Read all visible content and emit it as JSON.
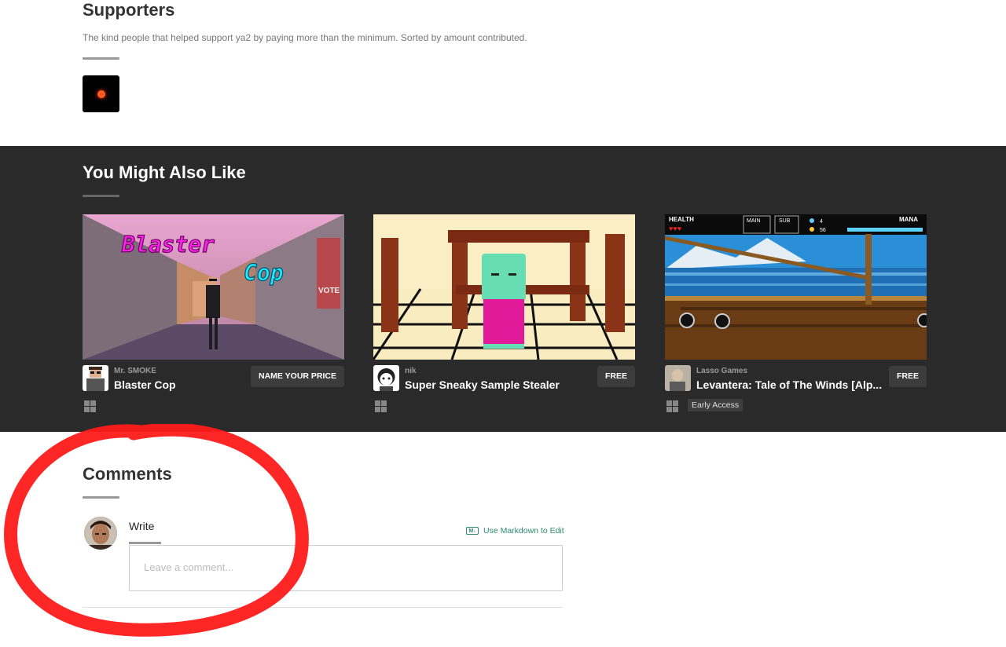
{
  "supporters": {
    "title": "Supporters",
    "description": "The kind people that helped support ya2 by paying more than the minimum. Sorted by amount contributed."
  },
  "also_like": {
    "title": "You Might Also Like",
    "games": [
      {
        "author": "Mr. SMOKE",
        "title": "Blaster Cop",
        "price": "NAME YOUR PRICE",
        "tag": ""
      },
      {
        "author": "nik",
        "title": "Super Sneaky Sample Stealer",
        "price": "FREE",
        "tag": ""
      },
      {
        "author": "Lasso Games",
        "title": "Levantera: Tale of The Winds [Alp...",
        "price": "FREE",
        "tag": "Early Access"
      }
    ],
    "thumb_text": {
      "blaster_line1": "Blaster",
      "blaster_line2": "Cop",
      "vote": "VOTE",
      "hud_health": "HEALTH",
      "hud_main": "MAIN",
      "hud_sub": "SUB",
      "hud_mana": "MANA",
      "hud_gems": "4",
      "hud_coins": "56"
    }
  },
  "comments": {
    "title": "Comments",
    "write_tab": "Write",
    "markdown_link": "Use Markdown to Edit",
    "markdown_icon": "M↓",
    "placeholder": "Leave a comment..."
  },
  "colors": {
    "dark_section": "#2a2a2a",
    "markdown_link": "#2e8b6f",
    "annotation_circle": "#ff1a1a"
  }
}
